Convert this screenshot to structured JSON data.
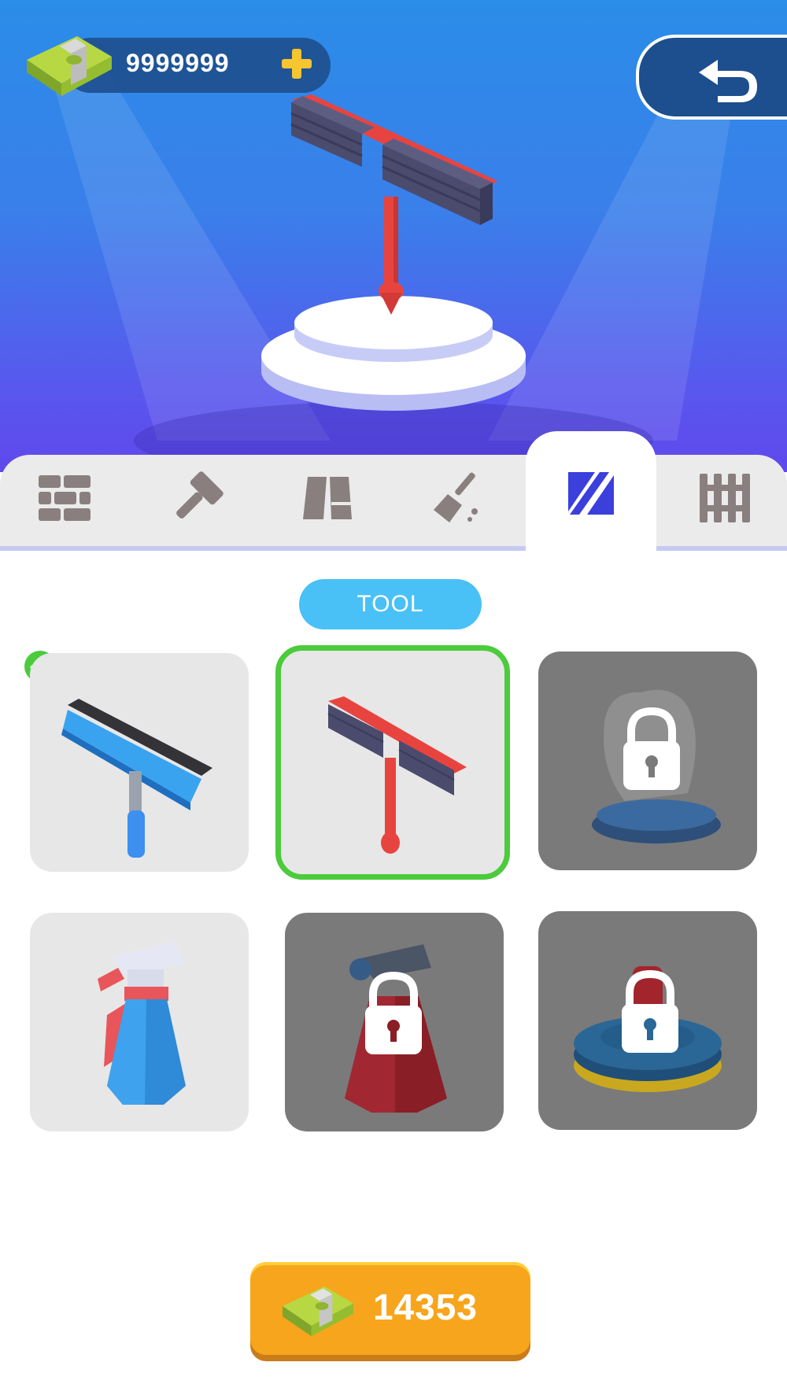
{
  "hud": {
    "money_value": "9999999",
    "money_icon": "cash-stack-icon",
    "plus_icon": "plus-icon",
    "back_icon": "undo-arrow-icon"
  },
  "showcase": {
    "item_icon": "red-squeegee-on-pedestal"
  },
  "tabs": [
    {
      "icon": "bricks-icon",
      "active": false
    },
    {
      "icon": "hammer-icon",
      "active": false
    },
    {
      "icon": "door-panel-icon",
      "active": false
    },
    {
      "icon": "broom-icon",
      "active": false
    },
    {
      "icon": "squeegee-slash-icon",
      "active": true
    },
    {
      "icon": "fence-icon",
      "active": false
    }
  ],
  "section": {
    "label": "TOOL"
  },
  "items": [
    {
      "icon": "blue-squeegee",
      "state": "owned",
      "equipped": true
    },
    {
      "icon": "red-squeegee",
      "state": "selected"
    },
    {
      "icon": "glove",
      "state": "locked"
    },
    {
      "icon": "blue-spray-bottle",
      "state": "owned"
    },
    {
      "icon": "red-spray-bottle",
      "state": "locked"
    },
    {
      "icon": "floor-polisher",
      "state": "locked"
    }
  ],
  "buy": {
    "price": "14353",
    "icon": "cash-stack-icon"
  },
  "colors": {
    "hero_top": "#2a8de8",
    "hero_bottom": "#5f48ec",
    "accent_blue": "#49c1f6",
    "selected_green": "#4ccb3c",
    "buy_orange": "#f7a51c",
    "tab_active_icon": "#3b3fdc"
  }
}
